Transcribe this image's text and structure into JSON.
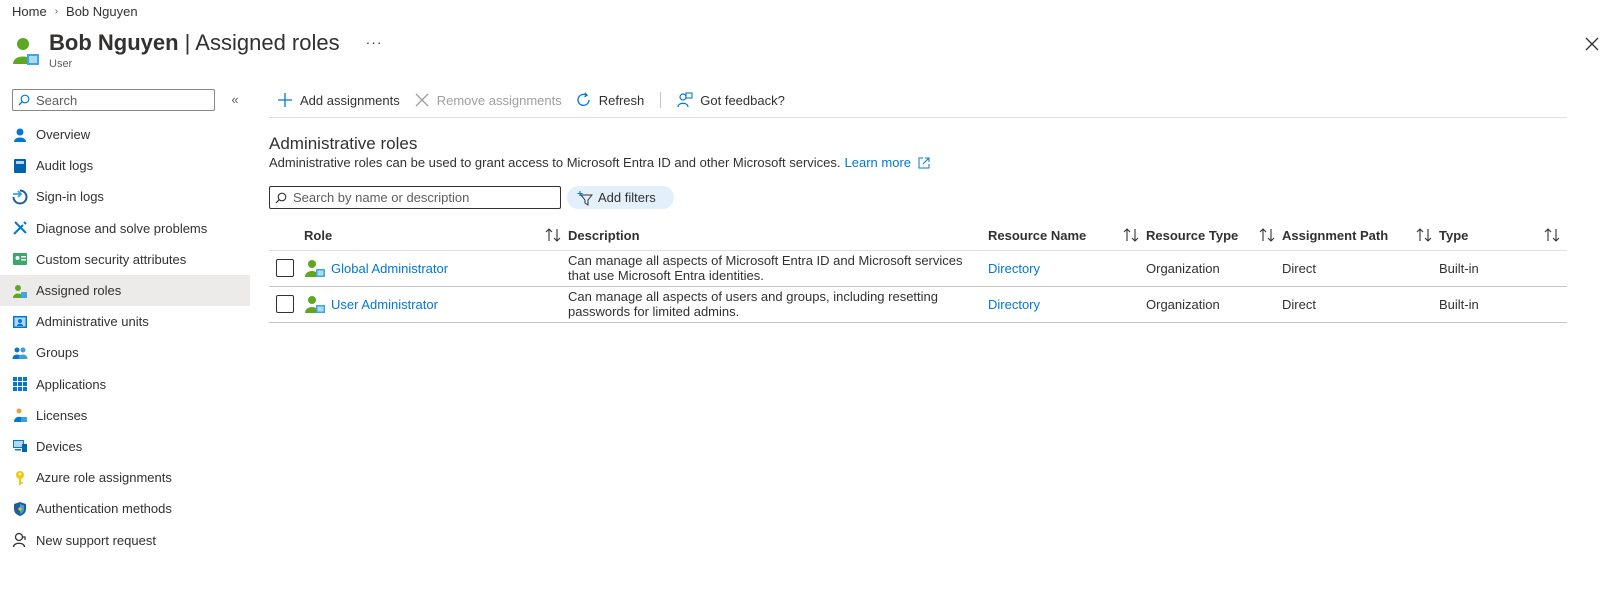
{
  "breadcrumb": {
    "home": "Home",
    "current": "Bob Nguyen"
  },
  "header": {
    "name": "Bob Nguyen",
    "separator": " | ",
    "page": "Assigned roles",
    "subtitle": "User",
    "more": "···"
  },
  "sidebar": {
    "search_placeholder": "Search",
    "collapse": "«",
    "items": [
      {
        "label": "Overview",
        "icon": "person-icon"
      },
      {
        "label": "Audit logs",
        "icon": "book-icon"
      },
      {
        "label": "Sign-in logs",
        "icon": "sign-in-icon"
      },
      {
        "label": "Diagnose and solve problems",
        "icon": "wrench-icon"
      },
      {
        "label": "Custom security attributes",
        "icon": "attributes-icon"
      },
      {
        "label": "Assigned roles",
        "icon": "user-role-icon",
        "active": true
      },
      {
        "label": "Administrative units",
        "icon": "admin-units-icon"
      },
      {
        "label": "Groups",
        "icon": "groups-icon"
      },
      {
        "label": "Applications",
        "icon": "grid-icon"
      },
      {
        "label": "Licenses",
        "icon": "license-icon"
      },
      {
        "label": "Devices",
        "icon": "devices-icon"
      },
      {
        "label": "Azure role assignments",
        "icon": "key-icon"
      },
      {
        "label": "Authentication methods",
        "icon": "shield-icon"
      },
      {
        "label": "New support request",
        "icon": "support-icon"
      }
    ]
  },
  "toolbar": {
    "add": "Add assignments",
    "remove": "Remove assignments",
    "refresh": "Refresh",
    "feedback": "Got feedback?"
  },
  "section": {
    "title": "Administrative roles",
    "description": "Administrative roles can be used to grant access to Microsoft Entra ID and other Microsoft services.",
    "learn_more": "Learn more"
  },
  "filters": {
    "search_placeholder": "Search by name or description",
    "add_filters": "Add filters"
  },
  "table": {
    "columns": {
      "role": "Role",
      "description": "Description",
      "resource_name": "Resource Name",
      "resource_type": "Resource Type",
      "assignment_path": "Assignment Path",
      "type": "Type"
    },
    "rows": [
      {
        "role": "Global Administrator",
        "description": "Can manage all aspects of Microsoft Entra ID and Microsoft services that use Microsoft Entra identities.",
        "resource_name": "Directory",
        "resource_type": "Organization",
        "assignment_path": "Direct",
        "type": "Built-in"
      },
      {
        "role": "User Administrator",
        "description": "Can manage all aspects of users and groups, including resetting passwords for limited admins.",
        "resource_name": "Directory",
        "resource_type": "Organization",
        "assignment_path": "Direct",
        "type": "Built-in"
      }
    ]
  }
}
